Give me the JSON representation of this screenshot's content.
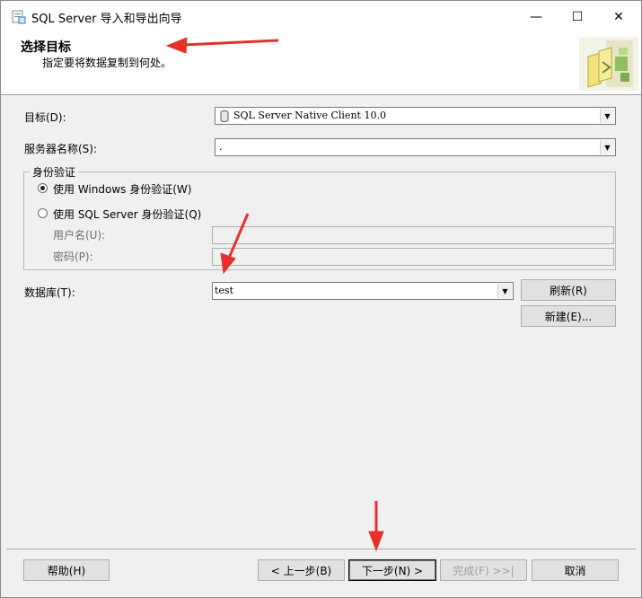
{
  "window": {
    "title": "SQL Server 导入和导出向导",
    "controls": {
      "minimize": "—",
      "maximize": "☐",
      "close": "✕"
    }
  },
  "header": {
    "title": "选择目标",
    "subtitle": "指定要将数据复制到何处。"
  },
  "form": {
    "destination": {
      "label": "目标(D):",
      "value": "SQL Server Native Client 10.0"
    },
    "server": {
      "label": "服务器名称(S):",
      "value": "."
    },
    "auth": {
      "group_title": "身份验证",
      "windows": {
        "label": "使用 Windows 身份验证(W)",
        "selected": true
      },
      "sql": {
        "label": "使用 SQL Server 身份验证(Q)",
        "selected": false
      },
      "username_label": "用户名(U):",
      "password_label": "密码(P):"
    },
    "database": {
      "label": "数据库(T):",
      "value": "test"
    },
    "refresh_button": "刷新(R)",
    "new_button": "新建(E)..."
  },
  "footer": {
    "help": "帮助(H)",
    "back": "< 上一步(B)",
    "next": "下一步(N) >",
    "finish": "完成(F) >>|",
    "cancel": "取消"
  },
  "annotation_color": "#e8302a"
}
